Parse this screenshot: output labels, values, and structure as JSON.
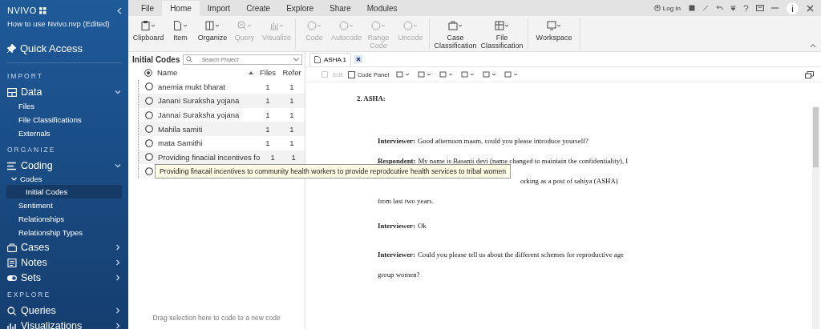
{
  "app": {
    "logo": "NVIVO",
    "project": "How to use Nvivo.nvp (Edited)",
    "quick_access": "Quick Access"
  },
  "nav": [
    {
      "kind": "heading",
      "label": "IMPORT"
    },
    {
      "kind": "group",
      "label": "Data",
      "expanded": true,
      "children": [
        {
          "kind": "link",
          "label": "Files",
          "selected": false
        },
        {
          "kind": "link",
          "label": "File Classifications",
          "selected": false
        },
        {
          "kind": "link",
          "label": "Externals",
          "selected": false
        }
      ]
    },
    {
      "kind": "heading",
      "label": "ORGANIZE"
    },
    {
      "kind": "group",
      "label": "Coding",
      "expanded": true,
      "children": [
        {
          "kind": "sub",
          "label": "Codes",
          "expanded": true,
          "children": [
            {
              "kind": "link",
              "label": "Initial Codes",
              "selected": true
            }
          ]
        },
        {
          "kind": "link",
          "label": "Sentiment",
          "selected": false
        },
        {
          "kind": "link",
          "label": "Relationships",
          "selected": false
        },
        {
          "kind": "link",
          "label": "Relationship Types",
          "selected": false
        }
      ]
    },
    {
      "kind": "group",
      "label": "Cases",
      "expanded": false
    },
    {
      "kind": "group",
      "label": "Notes",
      "expanded": false
    },
    {
      "kind": "group",
      "label": "Sets",
      "expanded": false
    },
    {
      "kind": "heading",
      "label": "EXPLORE"
    },
    {
      "kind": "group",
      "label": "Queries",
      "expanded": false
    },
    {
      "kind": "group",
      "label": "Visualizations",
      "expanded": false
    }
  ],
  "menu_tabs": [
    {
      "label": "File",
      "selected": false
    },
    {
      "label": "Home",
      "selected": true
    },
    {
      "label": "Import",
      "selected": false
    },
    {
      "label": "Create",
      "selected": false
    },
    {
      "label": "Explore",
      "selected": false
    },
    {
      "label": "Share",
      "selected": false
    },
    {
      "label": "Modules",
      "selected": false
    }
  ],
  "login": "Log In",
  "ribbon": [
    [
      {
        "label": "Clipboard",
        "disabled": false
      },
      {
        "label": "Item",
        "disabled": false
      },
      {
        "label": "Organize",
        "disabled": false
      },
      {
        "label": "Query",
        "disabled": true
      },
      {
        "label": "Visualize",
        "disabled": true
      }
    ],
    [
      {
        "label": "Code",
        "disabled": true
      },
      {
        "label": "Autocode",
        "disabled": true
      },
      {
        "label": "Range Code",
        "disabled": true
      },
      {
        "label": "Uncode",
        "disabled": true
      }
    ],
    [
      {
        "label": "Case Classification",
        "disabled": false
      },
      {
        "label": "File Classification",
        "disabled": false
      }
    ],
    [
      {
        "label": "Workspace",
        "disabled": false
      }
    ]
  ],
  "codes_panel": {
    "title": "Initial Codes",
    "search": {
      "placeholder": "Search Project"
    },
    "columns": [
      "Name",
      "Files",
      "Refer"
    ],
    "rows": [
      {
        "name": "anemia mukt bharat",
        "files": "1",
        "refer": "1"
      },
      {
        "name": "Janani Suraksha yojana",
        "files": "1",
        "refer": "1"
      },
      {
        "name": "Jannai Suraksha yojana",
        "files": "1",
        "refer": "1"
      },
      {
        "name": "Mahila samiti",
        "files": "1",
        "refer": "1"
      },
      {
        "name": "mata Samithi",
        "files": "1",
        "refer": "1"
      },
      {
        "name": "Providing  finacial incentives fo",
        "files": "1",
        "refer": "1"
      }
    ],
    "drop_hint": "Drag selection here to code to a new code"
  },
  "tooltip": "Providing finacail incentives to community health workers to provide reprodcutive health services to tribal women",
  "document": {
    "tab": "ASHA 1",
    "edit": "Edit",
    "code_panel": {
      "label": "Code Panel",
      "checked": false
    },
    "heading": "2. ASHA:",
    "paragraphs": [
      {
        "speaker": "Interviewer:",
        "lines": [
          {
            "text": "Good afternoon maam, could you please introduce yourself?",
            "covered": false
          }
        ]
      },
      {
        "speaker": "Respondent:",
        "lines": [
          {
            "text": "My name is Basanti devi (name changed to maintain the confidentiality), I",
            "covered": false
          },
          {
            "text": "orking as a post of sahiya (ASHA)",
            "covered": true
          },
          {
            "text": "from last two years.",
            "covered": false
          }
        ]
      },
      {
        "speaker": "Interviewer:",
        "lines": [
          {
            "text": "Ok",
            "covered": false
          }
        ]
      },
      {
        "speaker": "Interviewer:",
        "lines": [
          {
            "text": "Could you please tell us about the different schemes for reproductive age",
            "covered": false
          },
          {
            "text": "group women?",
            "covered": false
          }
        ]
      }
    ]
  }
}
